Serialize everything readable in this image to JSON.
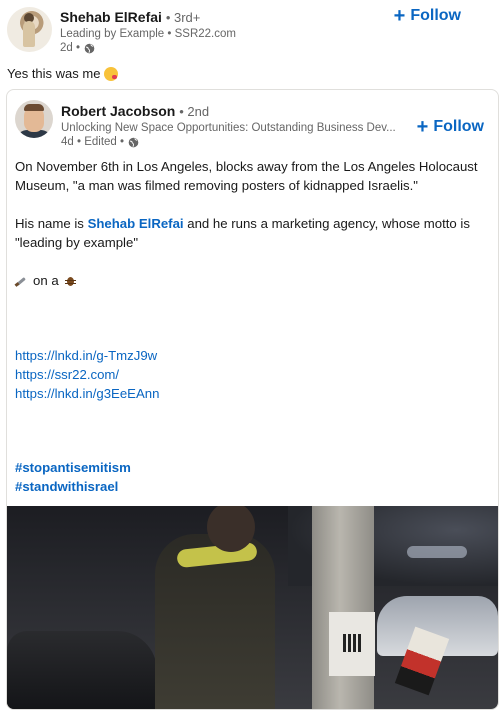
{
  "outer_post": {
    "author_name": "Shehab ElRefai",
    "degree": "3rd+",
    "headline": "Leading by Example • SSR22.com",
    "time": "2d •",
    "follow_label": "Follow",
    "text": "Yes this was me"
  },
  "shared_post": {
    "author_name": "Robert Jacobson",
    "degree": "2nd",
    "headline": "Unlocking New Space Opportunities: Outstanding Business Dev...",
    "time": "4d • Edited •",
    "follow_label": "Follow",
    "paragraph1": "On November 6th in Los Angeles, blocks away from the Los Angeles Holocaust Museum, \"a man was filmed removing posters of kidnapped Israelis.\"",
    "paragraph2_before": "His name is",
    "paragraph2_mention": "Shehab ElRefai",
    "paragraph2_after": "and he runs a marketing agency, whose motto is \"leading by example\"",
    "emoji_line_text": "on a",
    "links": [
      "https://lnkd.in/g-TmzJ9w",
      "https://ssr22.com/",
      "https://lnkd.in/g3EeEAnn"
    ],
    "hashtags": [
      "#stopantisemitism",
      "#standwithisrael"
    ]
  },
  "icons": {
    "globe": "globe-icon",
    "plus": "plus-icon",
    "kiss_emoji": "kissing-face-emoji-icon",
    "knife_emoji": "knife-emoji-icon",
    "bug_emoji": "cockroach-emoji-icon"
  },
  "colors": {
    "link_blue": "#0a66c2",
    "muted_text": "#666666"
  }
}
